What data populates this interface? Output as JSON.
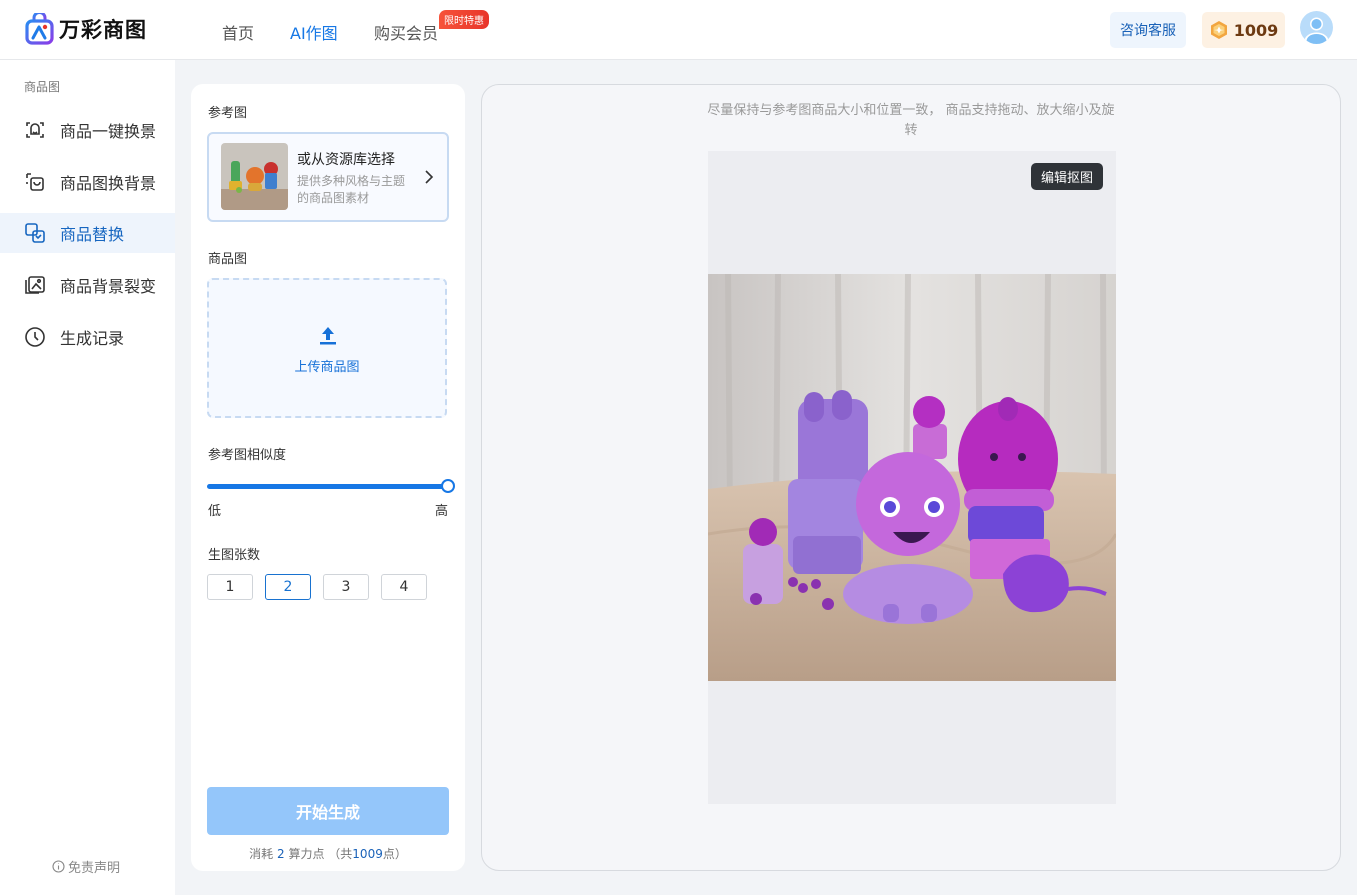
{
  "header": {
    "app_name": "万彩商图",
    "nav": [
      {
        "label": "首页",
        "active": false
      },
      {
        "label": "AI作图",
        "active": true
      },
      {
        "label": "购买会员",
        "active": false
      }
    ],
    "promo_badge": "限时特惠",
    "consult_label": "咨询客服",
    "points": "1009",
    "icons": [
      "logo-icon",
      "coin-icon",
      "avatar-icon"
    ]
  },
  "sidebar": {
    "category": "商品图",
    "items": [
      {
        "label": "商品一键换景",
        "icon": "scene-swap-icon"
      },
      {
        "label": "商品图换背景",
        "icon": "background-swap-icon"
      },
      {
        "label": "商品替换",
        "icon": "product-replace-icon",
        "active": true
      },
      {
        "label": "商品背景裂变",
        "icon": "background-variant-icon"
      },
      {
        "label": "生成记录",
        "icon": "clock-icon"
      }
    ],
    "disclaimer": "免责声明"
  },
  "panel": {
    "ref_label": "参考图",
    "ref_card_title": "或从资源库选择",
    "ref_card_desc": "提供多种风格与主题的商品图素材",
    "product_label": "商品图",
    "upload_label": "上传商品图",
    "similarity_label": "参考图相似度",
    "similarity_value": 1.0,
    "similarity_low": "低",
    "similarity_high": "高",
    "count_label": "生图张数",
    "counts": [
      "1",
      "2",
      "3",
      "4"
    ],
    "count_selected": "2",
    "generate_label": "开始生成",
    "cost_prefix": "消耗",
    "cost_amount": "2",
    "cost_unit": "算力点",
    "cost_total_prefix": "（共",
    "cost_total": "1009",
    "cost_total_suffix": "点）"
  },
  "canvas": {
    "hint": "尽量保持与参考图商品大小和位置一致， 商品支持拖动、放大缩小及旋转",
    "edit_label": "编辑抠图"
  },
  "colors": {
    "accent": "#1677e5",
    "generate_disabled": "#94c6fa",
    "promo": "#e8342a",
    "points_bg": "#fdf1e3"
  }
}
